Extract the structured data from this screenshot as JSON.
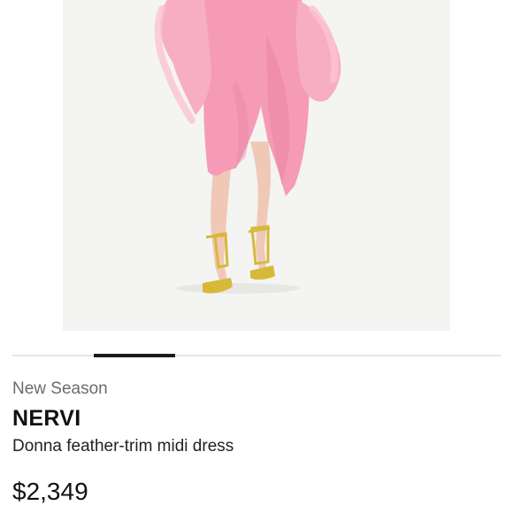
{
  "product": {
    "image_alt": "Model wearing pink feather-trim midi dress with gold strappy sandals",
    "carousel": {
      "current_slide": 2,
      "total_slides": 6
    },
    "season_label": "New Season",
    "brand": "NERVI",
    "name": "Donna feather-trim midi dress",
    "price": "$2,349"
  },
  "colors": {
    "dress_pink": "#f59bb7",
    "feather_pink": "#f7aec4",
    "sandal_gold": "#d7b93a",
    "indicator": "#1b1b1b",
    "track": "#e4e4e4"
  }
}
